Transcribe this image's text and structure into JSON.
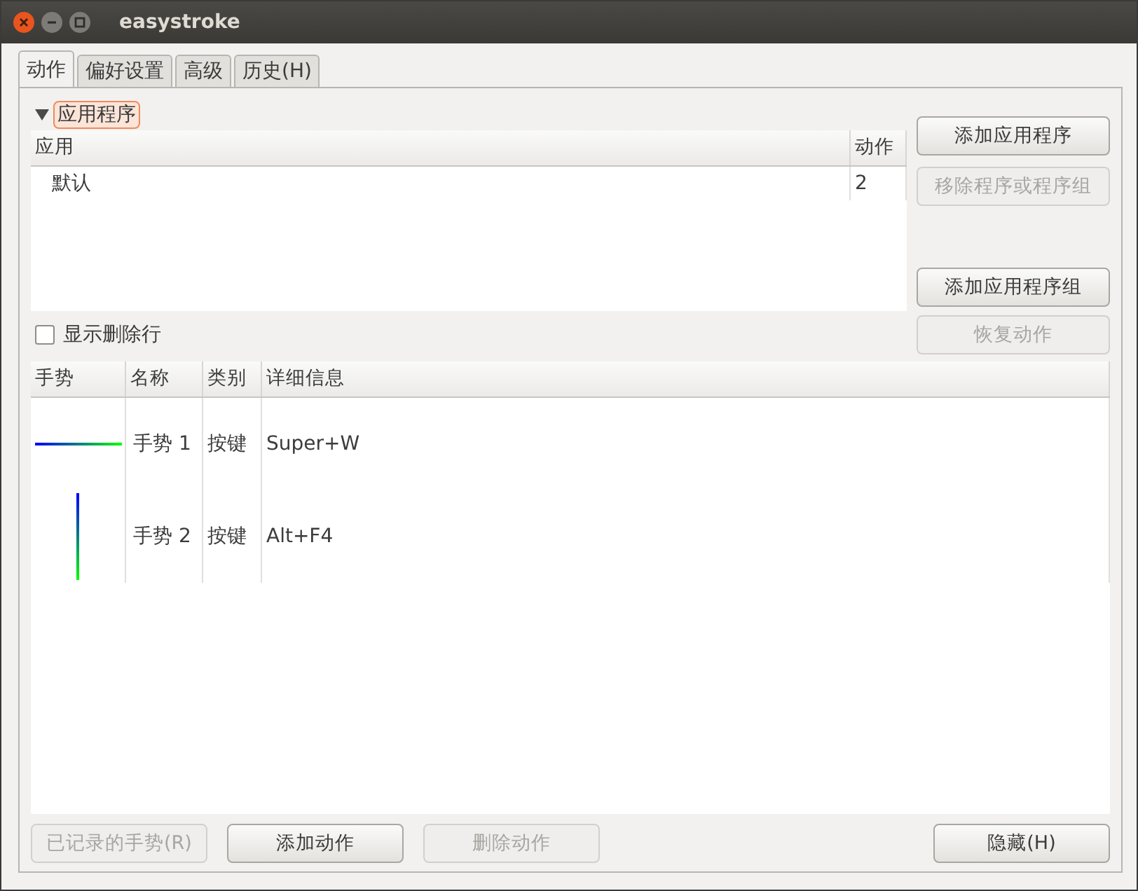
{
  "window": {
    "title": "easystroke"
  },
  "tabs": [
    {
      "label": "动作",
      "selected": true
    },
    {
      "label": "偏好设置",
      "selected": false
    },
    {
      "label": "高级",
      "selected": false
    },
    {
      "label": "历史(H)",
      "selected": false
    }
  ],
  "expander": {
    "label": "应用程序",
    "expanded": true
  },
  "apps_table": {
    "columns": [
      "应用",
      "动作"
    ],
    "rows": [
      {
        "cells": [
          "默认",
          "2"
        ]
      }
    ]
  },
  "app_buttons": [
    {
      "label": "添加应用程序",
      "disabled": false
    },
    {
      "label": "移除程序或程序组",
      "disabled": true
    },
    {
      "label": "添加应用程序组",
      "disabled": false
    },
    {
      "label": "恢复动作",
      "disabled": true
    }
  ],
  "show_deleted": {
    "label": "显示删除行",
    "checked": false
  },
  "actions_table": {
    "columns": [
      "手势",
      "名称",
      "类别",
      "详细信息"
    ],
    "rows": [
      {
        "gesture": {
          "kind": "right"
        },
        "cells": [
          "",
          "手势 1",
          "按键",
          "Super+W"
        ]
      },
      {
        "gesture": {
          "kind": "down"
        },
        "cells": [
          "",
          "手势 2",
          "按键",
          "Alt+F4"
        ]
      }
    ]
  },
  "bottom_buttons": [
    {
      "label": "已记录的手势(R)",
      "disabled": true
    },
    {
      "label": "添加动作",
      "disabled": false
    },
    {
      "label": "删除动作",
      "disabled": true
    },
    {
      "label": "隐藏(H)",
      "disabled": false
    }
  ]
}
